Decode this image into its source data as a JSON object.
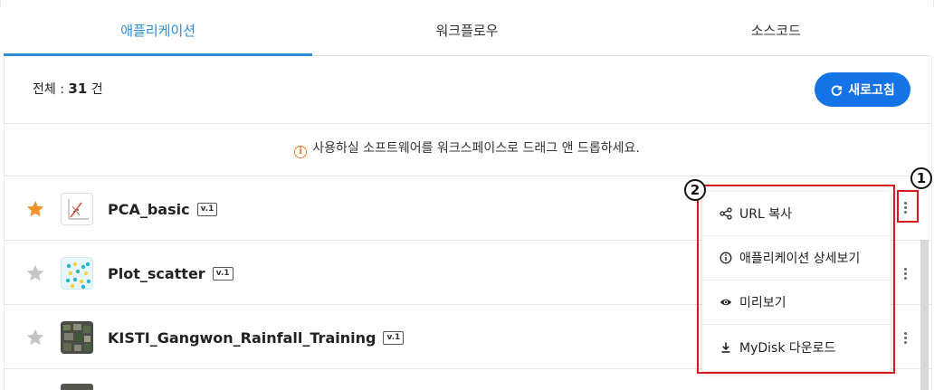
{
  "tabs": [
    {
      "label": "애플리케이션",
      "active": true
    },
    {
      "label": "워크플로우",
      "active": false
    },
    {
      "label": "소스코드",
      "active": false
    }
  ],
  "summary": {
    "label": "전체 : ",
    "count": "31",
    "unit": " 건"
  },
  "refresh_button": {
    "label": "새로고침",
    "icon": "refresh-icon"
  },
  "notice": {
    "icon": "info-icon",
    "text": "사용하실 소프트웨어를 워크스페이스로 드래그 앤 드롭하세요."
  },
  "apps": [
    {
      "name": "PCA_basic",
      "version": "v.1",
      "starred": true,
      "thumbnail": "pca-chart-thumbnail"
    },
    {
      "name": "Plot_scatter",
      "version": "v.1",
      "starred": false,
      "thumbnail": "scatter-dots-thumbnail"
    },
    {
      "name": "KISTI_Gangwon_Rainfall_Training",
      "version": "v.1",
      "starred": false,
      "thumbnail": "map-thumbnail"
    }
  ],
  "context_menu": {
    "items": [
      {
        "label": "URL 복사",
        "icon": "share-icon"
      },
      {
        "label": "애플리케이션 상세보기",
        "icon": "info-icon"
      },
      {
        "label": "미리보기",
        "icon": "eye-icon"
      },
      {
        "label": "MyDisk 다운로드",
        "icon": "download-icon"
      }
    ]
  },
  "callouts": [
    "1",
    "2"
  ],
  "colors": {
    "accent": "#2d8ed3",
    "button": "#1473e6",
    "star_active": "#f2922a",
    "star_inactive": "#c4c4c4",
    "highlight": "#d9181e",
    "notice_icon": "#e97b2a"
  }
}
